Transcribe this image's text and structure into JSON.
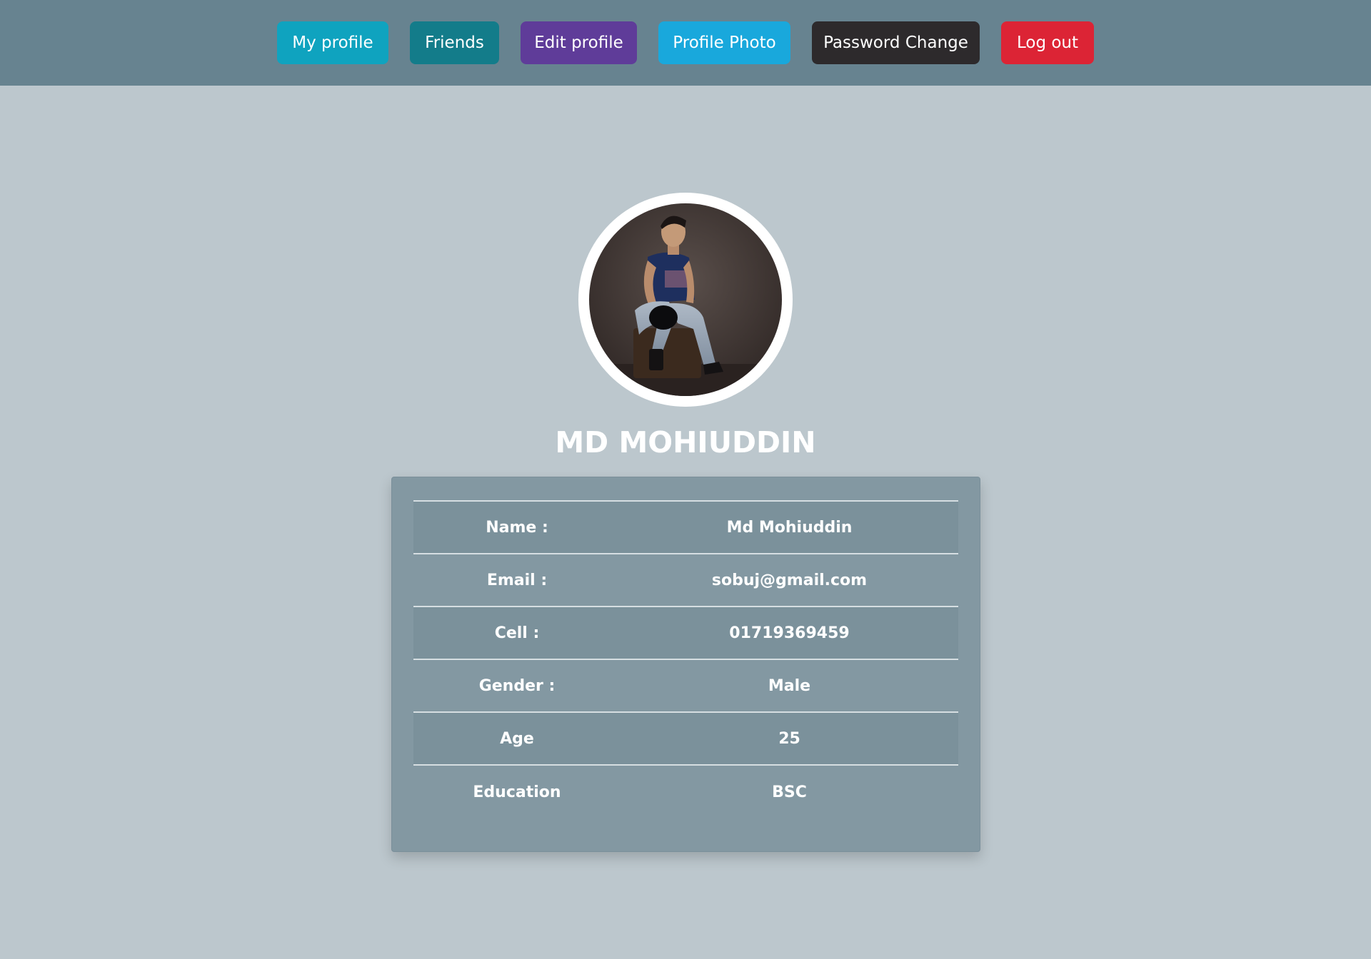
{
  "nav": {
    "buttons": [
      {
        "label": "My profile",
        "color": "#0fa3bf"
      },
      {
        "label": "Friends",
        "color": "#137c8a"
      },
      {
        "label": "Edit profile",
        "color": "#5f3c99"
      },
      {
        "label": "Profile Photo",
        "color": "#19a8dc"
      },
      {
        "label": "Password Change",
        "color": "#2d2a2c"
      },
      {
        "label": "Log out",
        "color": "#dc2435"
      }
    ]
  },
  "profile": {
    "display_name": "MD MOHIUDDIN",
    "fields": [
      {
        "label": "Name :",
        "value": "Md Mohiuddin"
      },
      {
        "label": "Email :",
        "value": "sobuj@gmail.com"
      },
      {
        "label": "Cell :",
        "value": "01719369459"
      },
      {
        "label": "Gender :",
        "value": "Male"
      },
      {
        "label": "Age",
        "value": "25"
      },
      {
        "label": "Education",
        "value": "BSC"
      }
    ]
  }
}
